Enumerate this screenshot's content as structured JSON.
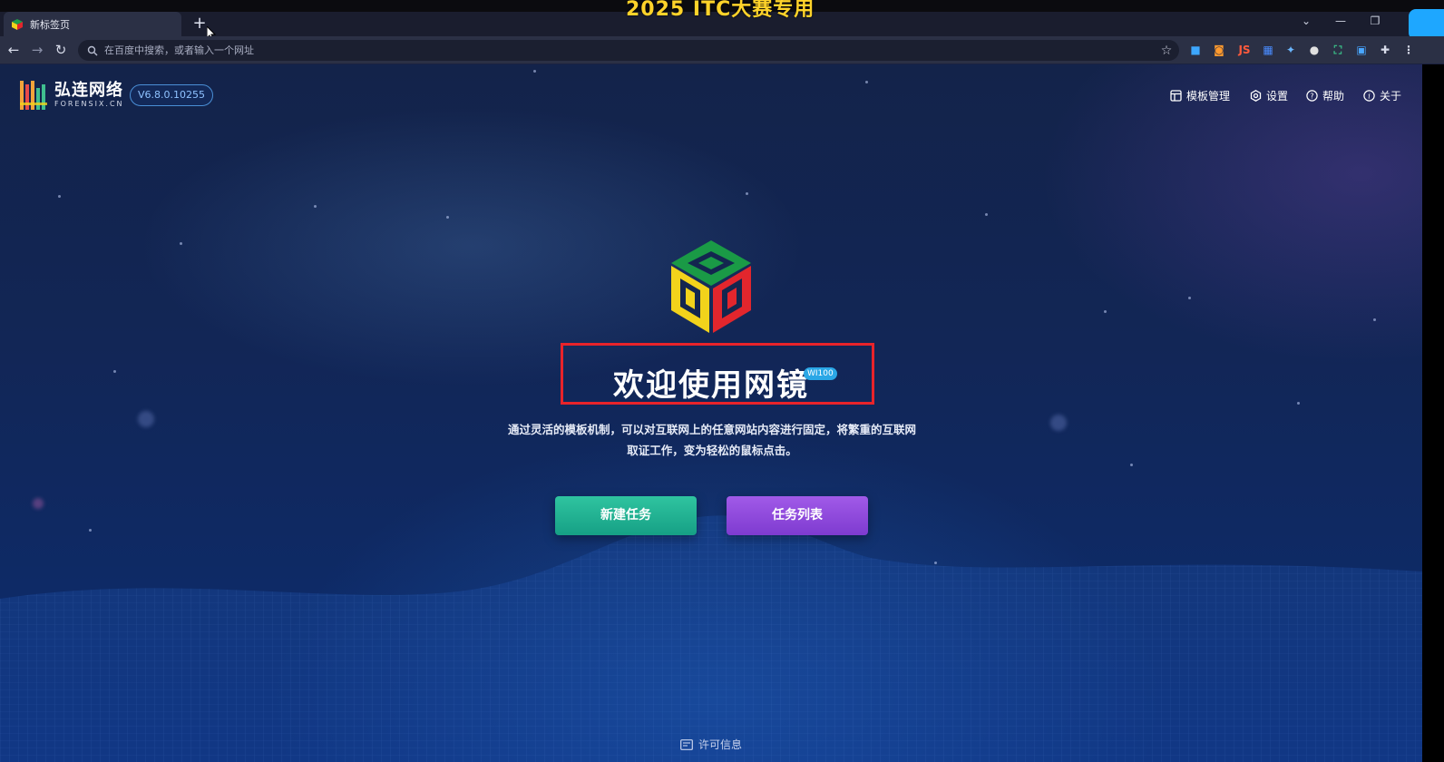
{
  "overlay_caption": "2025 ITC大赛专用",
  "browser": {
    "tab_title": "新标签页",
    "new_tab_icon": "+",
    "omnibox_placeholder": "在百度中搜索，或者输入一个网址",
    "extension_js_label": "JS"
  },
  "header": {
    "brand_name": "弘连网络",
    "brand_domain": "FORENSIX.CN",
    "version": "V6.8.0.10255",
    "nav": [
      {
        "label": "模板管理",
        "icon": "template-icon"
      },
      {
        "label": "设置",
        "icon": "settings-icon"
      },
      {
        "label": "帮助",
        "icon": "help-icon"
      },
      {
        "label": "关于",
        "icon": "info-icon"
      }
    ]
  },
  "hero": {
    "title": "欢迎使用网镜",
    "badge": "WI100",
    "description_line1": "通过灵活的模板机制，可以对互联网上的任意网站内容进行固定，将繁重的互联网",
    "description_line2": "取证工作，变为轻松的鼠标点击。",
    "buttons": {
      "new_task": "新建任务",
      "task_list": "任务列表"
    }
  },
  "footer": {
    "license": "许可信息"
  },
  "colors": {
    "highlight_box": "#e8232a",
    "new_task_button": "#1fb394",
    "task_list_button": "#8b46da",
    "version_border": "#4a8fd6"
  }
}
